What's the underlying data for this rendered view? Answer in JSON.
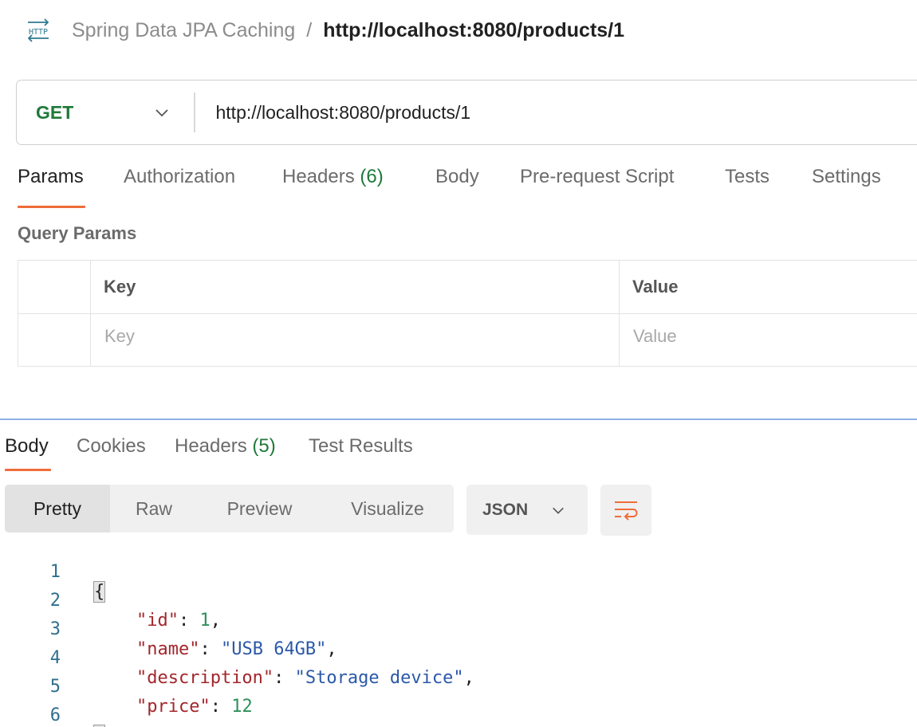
{
  "header": {
    "icon": "http-icon",
    "collection": "Spring Data JPA Caching",
    "separator": "/",
    "request_name": "http://localhost:8080/products/1"
  },
  "request": {
    "method": "GET",
    "url": "http://localhost:8080/products/1"
  },
  "request_tabs": [
    {
      "label": "Params",
      "active": true
    },
    {
      "label": "Authorization"
    },
    {
      "label": "Headers",
      "count": "(6)"
    },
    {
      "label": "Body"
    },
    {
      "label": "Pre-request Script"
    },
    {
      "label": "Tests"
    },
    {
      "label": "Settings"
    }
  ],
  "query_params": {
    "title": "Query Params",
    "columns": [
      "Key",
      "Value"
    ],
    "placeholders": {
      "key": "Key",
      "value": "Value"
    }
  },
  "response_tabs": [
    {
      "label": "Body",
      "active": true
    },
    {
      "label": "Cookies"
    },
    {
      "label": "Headers",
      "count": "(5)"
    },
    {
      "label": "Test Results"
    }
  ],
  "body_toolbar": {
    "views": [
      "Pretty",
      "Raw",
      "Preview",
      "Visualize"
    ],
    "active_view": "Pretty",
    "format": "JSON",
    "wrap_icon": "wrap-lines-icon"
  },
  "response_body": {
    "line_numbers": [
      "1",
      "2",
      "3",
      "4",
      "5",
      "6"
    ],
    "open_brace": "{",
    "close_brace": "}",
    "fields": [
      {
        "key": "\"id\"",
        "value": "1",
        "type": "number",
        "comma": true
      },
      {
        "key": "\"name\"",
        "value": "\"USB 64GB\"",
        "type": "string",
        "comma": true
      },
      {
        "key": "\"description\"",
        "value": "\"Storage device\"",
        "type": "string",
        "comma": true
      },
      {
        "key": "\"price\"",
        "value": "12",
        "type": "number",
        "comma": false
      }
    ]
  },
  "colors": {
    "accent": "#ef6c3a",
    "method_get": "#1f7a3a",
    "json_key": "#a3262c",
    "json_string": "#2b58a8",
    "json_number": "#2e8f5a"
  }
}
